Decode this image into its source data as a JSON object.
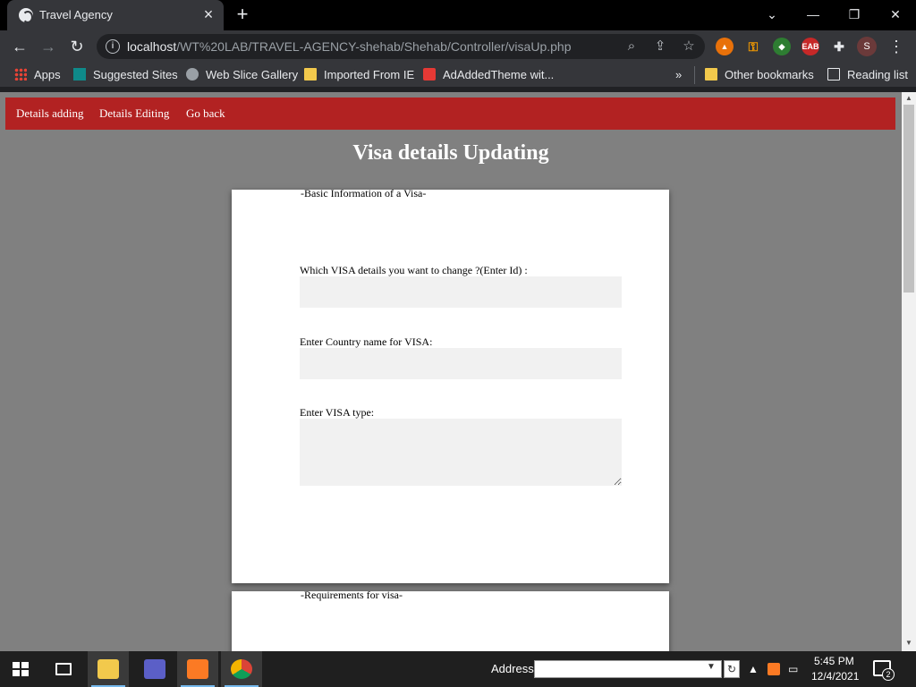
{
  "browser": {
    "tab_title": "Travel Agency",
    "url_host": "localhost",
    "url_path": "/WT%20LAB/TRAVEL-AGENCY-shehab/Shehab/Controller/visaUp.php",
    "profile_initial": "S"
  },
  "bookmarks": {
    "items": [
      "Apps",
      "Suggested Sites",
      "Web Slice Gallery",
      "Imported From IE",
      "AdAddedTheme wit..."
    ],
    "overflow": "»",
    "other": "Other bookmarks",
    "reading_list": "Reading list"
  },
  "page": {
    "nav": [
      "Details adding",
      "Details Editing",
      "Go back"
    ],
    "title": "Visa details Updating",
    "section1": {
      "legend": "Basic Information of a Visa",
      "fields": [
        {
          "label": "Which VISA details you want to change ?(Enter Id) :",
          "value": ""
        },
        {
          "label": "Enter Country name for VISA:",
          "value": ""
        },
        {
          "label": "Enter VISA type:",
          "value": ""
        }
      ]
    },
    "section2": {
      "legend": "Requirements for visa"
    },
    "colors": {
      "nav_bg": "#b22222",
      "page_bg": "#808080",
      "card_bg": "#ffffff",
      "input_bg": "#f1f1f1"
    }
  },
  "taskbar": {
    "address_label": "Address",
    "address_value": "",
    "time": "5:45 PM",
    "date": "12/4/2021",
    "notification_count": "2"
  }
}
